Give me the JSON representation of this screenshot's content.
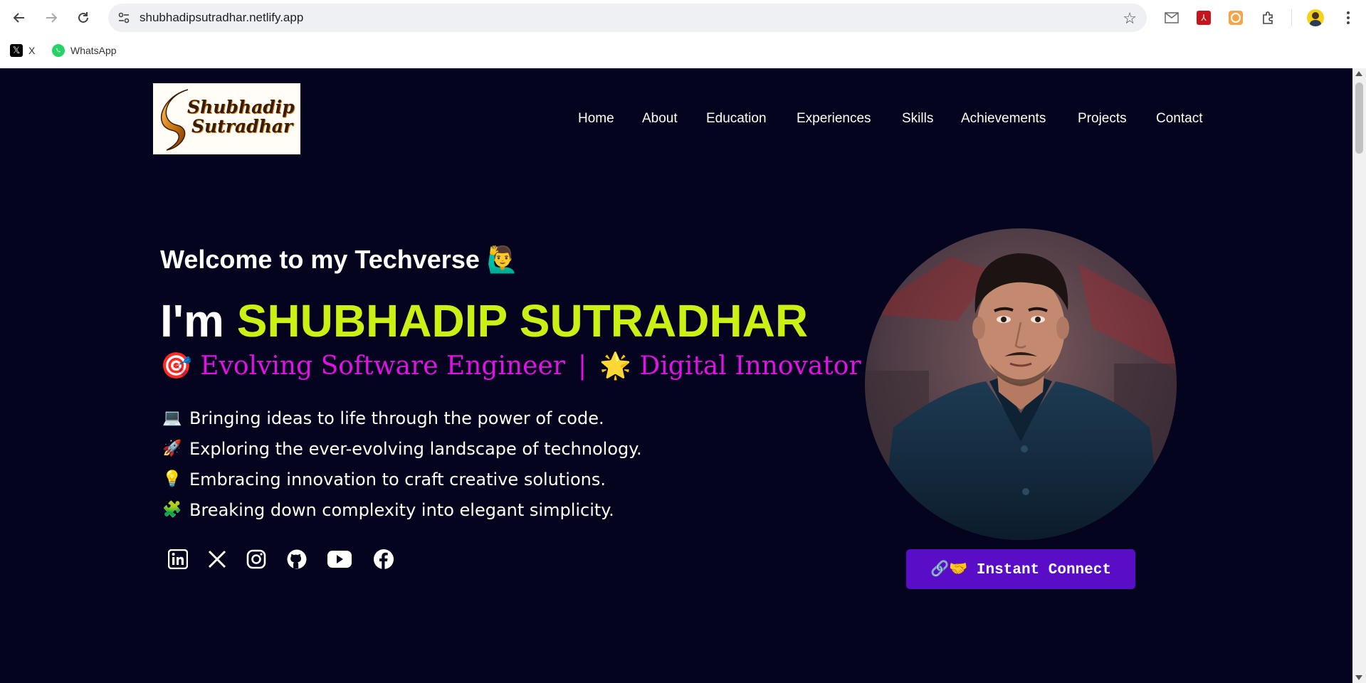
{
  "browser": {
    "url": "shubhadipsutradhar.netlify.app",
    "bookmarks": [
      {
        "label": "X",
        "icon": "x-logo-icon"
      },
      {
        "label": "WhatsApp",
        "icon": "whatsapp-icon"
      }
    ]
  },
  "header": {
    "logo_text_line1": "Shubhadip",
    "logo_text_line2": "Sutradhar",
    "nav": [
      "Home",
      "About",
      "Education",
      "Experiences",
      "Skills",
      "Achievements",
      "Projects",
      "Contact"
    ]
  },
  "hero": {
    "welcome": "Welcome to my Techverse 🙋‍♂️",
    "im": "I'm",
    "name": "SHUBHADIP SUTRADHAR",
    "tagline_1": "🎯 Evolving Software Engineer",
    "tagline_sep": "|",
    "tagline_2": "🌟 Digital Innovator",
    "bullets": [
      {
        "emoji": "💻",
        "text": "Bringing ideas to life through the power of code."
      },
      {
        "emoji": "🚀",
        "text": "Exploring the ever-evolving landscape of technology."
      },
      {
        "emoji": "💡",
        "text": "Embracing innovation to craft creative solutions."
      },
      {
        "emoji": "🧩",
        "text": "Breaking down complexity into elegant simplicity."
      }
    ],
    "socials": [
      "linkedin-icon",
      "x-icon",
      "instagram-icon",
      "github-icon",
      "youtube-icon",
      "facebook-icon"
    ],
    "connect_button": "🔗🤝 Instant Connect"
  },
  "colors": {
    "background": "#04041e",
    "name_accent": "#cbf014",
    "tagline": "#e211e6",
    "button": "#5a0dc6"
  }
}
